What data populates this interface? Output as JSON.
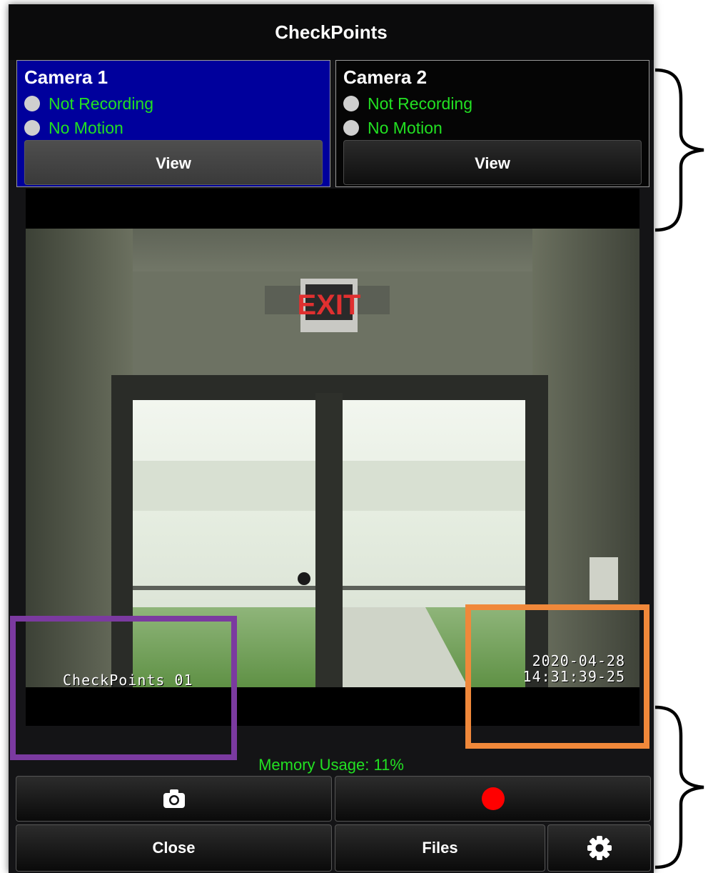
{
  "app": {
    "title": "CheckPoints"
  },
  "cameras": [
    {
      "name": "Camera 1",
      "recording_status": "Not Recording",
      "motion_status": "No Motion",
      "view_label": "View",
      "selected": true
    },
    {
      "name": "Camera 2",
      "recording_status": "Not Recording",
      "motion_status": "No Motion",
      "view_label": "View",
      "selected": false
    }
  ],
  "video": {
    "overlay_name": "CheckPoints 01",
    "overlay_date": "2020-04-28",
    "overlay_time": "14:31:39-25",
    "exit_sign": "EXIT"
  },
  "memory": {
    "label": "Memory Usage: 11%",
    "percent": 11
  },
  "controls": {
    "snapshot_icon": "camera-icon",
    "record_icon": "record-dot-icon",
    "close_label": "Close",
    "files_label": "Files",
    "settings_icon": "gear-icon"
  },
  "colors": {
    "status_green": "#22e022",
    "selected_card": "#00009c",
    "record_red": "#ff0000",
    "highlight_purple": "#7b3aa0",
    "highlight_orange": "#f0883a"
  }
}
